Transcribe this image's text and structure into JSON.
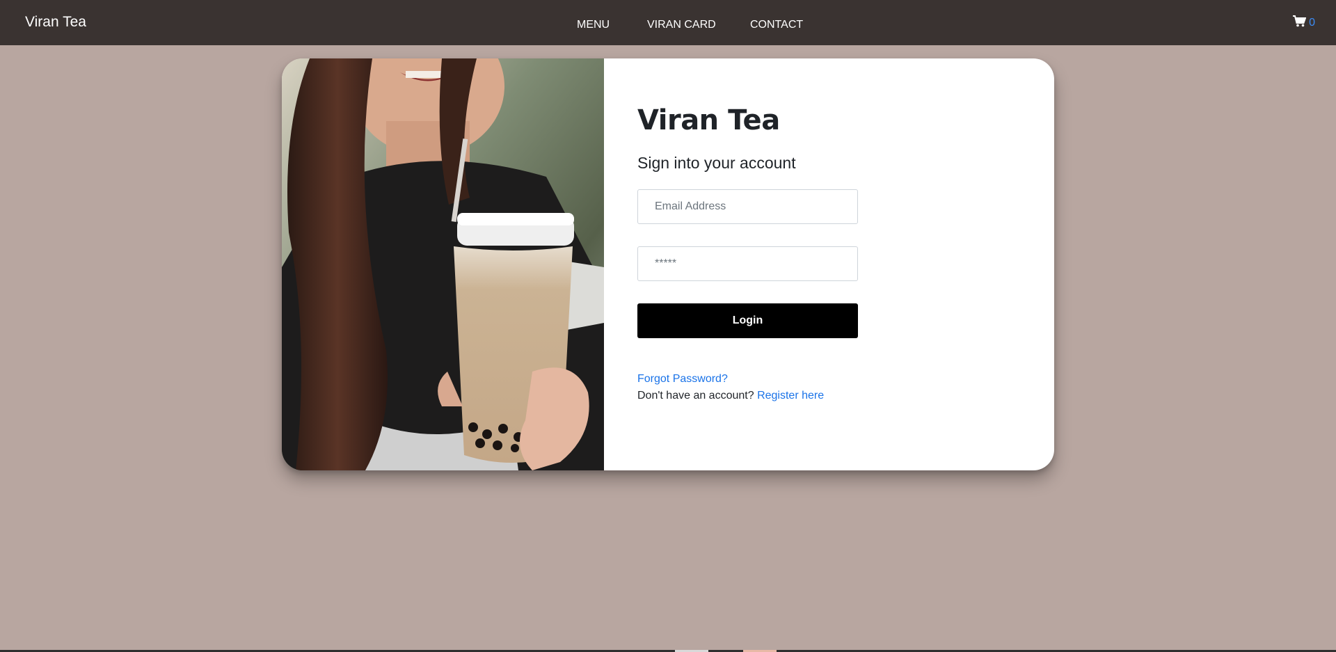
{
  "brand": "Viran Tea",
  "nav": {
    "items": [
      {
        "label": "MENU"
      },
      {
        "label": "VIRAN CARD"
      },
      {
        "label": "CONTACT"
      }
    ]
  },
  "cart": {
    "icon": "shopping-cart-icon",
    "count": "0"
  },
  "login": {
    "title": "Viran Tea",
    "subtitle": "Sign into your account",
    "email_placeholder": "Email Address",
    "password_placeholder": "*****",
    "button_label": "Login",
    "forgot_label": "Forgot Password?",
    "no_account_text": "Don't have an account?",
    "register_label": "Register here"
  },
  "colors": {
    "background": "#b8a6a0",
    "navbar": "#3a3331",
    "link": "#1a73e8",
    "cart_count": "#3b8cf5",
    "button": "#000000"
  }
}
